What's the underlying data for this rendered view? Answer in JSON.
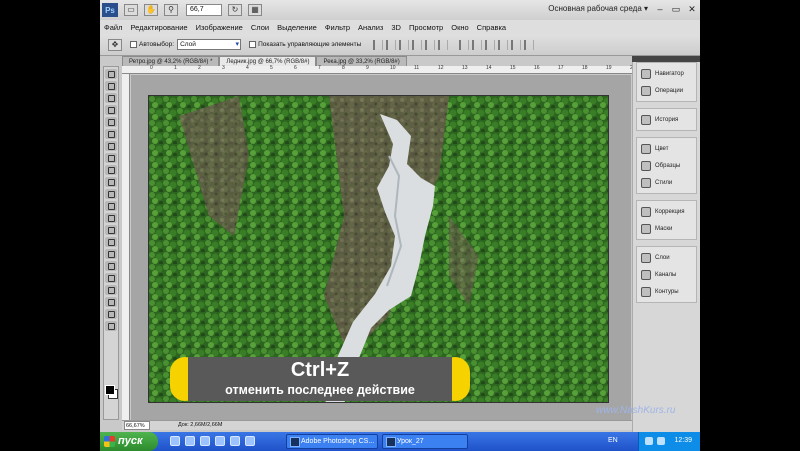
{
  "topbar": {
    "logo": "Ps",
    "zoom": "66,7",
    "workspace": "Основная рабочая среда ▾",
    "icons": [
      "screen-mode-icon",
      "hand-icon",
      "zoom-icon",
      "rotate-icon",
      "grid-icon"
    ]
  },
  "menu": [
    "Файл",
    "Редактирование",
    "Изображение",
    "Слои",
    "Выделение",
    "Фильтр",
    "Анализ",
    "3D",
    "Просмотр",
    "Окно",
    "Справка"
  ],
  "options": {
    "autoselect_label": "Автовыбор:",
    "autoselect_value": "Слой",
    "show_controls_label": "Показать управляющие элементы"
  },
  "tabs": [
    {
      "label": "Ретро.jpg @ 43,2% (RGB/8#) *",
      "active": false
    },
    {
      "label": "Ледник.jpg @ 66,7% (RGB/8#)",
      "active": true
    },
    {
      "label": "Река.jpg @ 33,2% (RGB/8#)",
      "active": false
    }
  ],
  "ruler": [
    "0",
    "1",
    "2",
    "3",
    "4",
    "5",
    "6",
    "7",
    "8",
    "9",
    "10",
    "11",
    "12",
    "13",
    "14",
    "15",
    "16",
    "17",
    "18",
    "19",
    "20"
  ],
  "panels": [
    [
      "Навигатор",
      "Операции"
    ],
    [
      "История"
    ],
    [
      "Цвет",
      "Образцы",
      "Стили"
    ],
    [
      "Коррекция",
      "Маски"
    ],
    [
      "Слои",
      "Каналы",
      "Контуры"
    ]
  ],
  "status": {
    "zoom": "66,67%",
    "doc": "Док: 2,66M/2,66M"
  },
  "overlay": {
    "title": "Ctrl+Z",
    "subtitle": "отменить последнее действие"
  },
  "watermark": "www.NashKurs.ru",
  "taskbar": {
    "start": "пуск",
    "items": [
      "Adobe Photoshop CS...",
      "Урок_27"
    ],
    "lang": "EN",
    "clock": "12:39"
  }
}
